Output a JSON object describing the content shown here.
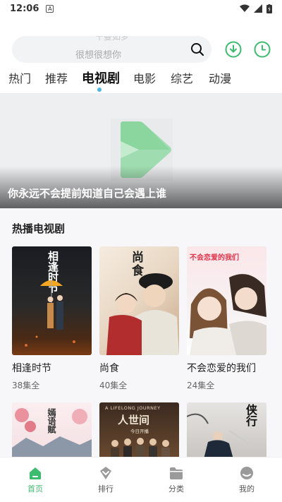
{
  "status": {
    "time": "12:06",
    "note_glyph": "A"
  },
  "search": {
    "ghost_text": "千曼如梦",
    "placeholder": "很想很想你"
  },
  "tabs": [
    "热门",
    "推荐",
    "电视剧",
    "电影",
    "综艺",
    "动漫"
  ],
  "active_tab_index": 2,
  "banner": {
    "caption": "你永远不会提前知道自己会遇上谁"
  },
  "section": {
    "title": "热播电视剧"
  },
  "shows": [
    {
      "title": "相逢时节",
      "episodes": "38集全",
      "poster_text": "相逢时节"
    },
    {
      "title": "尚食",
      "episodes": "40集全",
      "poster_text": "尚食"
    },
    {
      "title": "不会恋爱的我们",
      "episodes": "24集全",
      "poster_text": "不会恋爱的我们"
    }
  ],
  "shows_row2": [
    {
      "poster_text": "嫣语赋"
    },
    {
      "poster_text": "人世间",
      "poster_top": "A LIFELONG JOURNEY",
      "poster_sub": "今日开播"
    },
    {
      "poster_text": "侠行"
    }
  ],
  "nav": [
    {
      "label": "首页",
      "icon": "home-icon"
    },
    {
      "label": "排行",
      "icon": "rank-icon"
    },
    {
      "label": "分类",
      "icon": "folder-icon"
    },
    {
      "label": "我的",
      "icon": "profile-icon"
    }
  ],
  "colors": {
    "accent": "#3dbb6e",
    "tab_dot": "#4cb8e0",
    "nav_inactive": "#9a9a9a"
  }
}
